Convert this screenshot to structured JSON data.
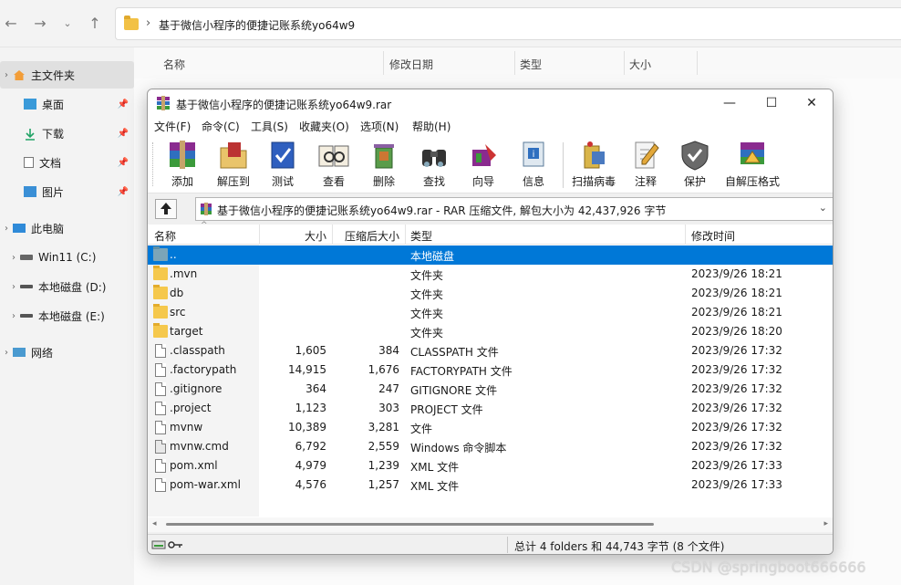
{
  "explorer": {
    "breadcrumb": "基于微信小程序的便捷记账系统yo64w9",
    "columns": [
      "名称",
      "修改日期",
      "类型",
      "大小"
    ],
    "sidebar": [
      {
        "label": "主文件夹",
        "icon": "home-icon"
      },
      {
        "label": "桌面",
        "icon": "desktop-icon"
      },
      {
        "label": "下载",
        "icon": "download-icon"
      },
      {
        "label": "文档",
        "icon": "document-icon"
      },
      {
        "label": "图片",
        "icon": "picture-icon"
      },
      {
        "label": "此电脑",
        "icon": "computer-icon"
      },
      {
        "label": "Win11 (C:)",
        "icon": "drive-icon"
      },
      {
        "label": "本地磁盘 (D:)",
        "icon": "drive-icon"
      },
      {
        "label": "本地磁盘 (E:)",
        "icon": "drive-icon"
      },
      {
        "label": "网络",
        "icon": "network-icon"
      }
    ]
  },
  "winrar": {
    "title": "基于微信小程序的便捷记账系统yo64w9.rar",
    "menu": [
      "文件(F)",
      "命令(C)",
      "工具(S)",
      "收藏夹(O)",
      "选项(N)",
      "帮助(H)"
    ],
    "toolbar": [
      "添加",
      "解压到",
      "测试",
      "查看",
      "删除",
      "查找",
      "向导",
      "信息",
      "扫描病毒",
      "注释",
      "保护",
      "自解压格式"
    ],
    "path": "基于微信小程序的便捷记账系统yo64w9.rar - RAR 压缩文件, 解包大小为 42,437,926 字节",
    "columns": [
      "名称",
      "大小",
      "压缩后大小",
      "类型",
      "修改时间"
    ],
    "rows": [
      {
        "name": "..",
        "size": "",
        "packed": "",
        "type": "本地磁盘",
        "modified": "",
        "kind": "up"
      },
      {
        "name": ".mvn",
        "size": "",
        "packed": "",
        "type": "文件夹",
        "modified": "2023/9/26 18:21",
        "kind": "folder"
      },
      {
        "name": "db",
        "size": "",
        "packed": "",
        "type": "文件夹",
        "modified": "2023/9/26 18:21",
        "kind": "folder"
      },
      {
        "name": "src",
        "size": "",
        "packed": "",
        "type": "文件夹",
        "modified": "2023/9/26 18:21",
        "kind": "folder"
      },
      {
        "name": "target",
        "size": "",
        "packed": "",
        "type": "文件夹",
        "modified": "2023/9/26 18:20",
        "kind": "folder"
      },
      {
        "name": ".classpath",
        "size": "1,605",
        "packed": "384",
        "type": "CLASSPATH 文件",
        "modified": "2023/9/26 17:32",
        "kind": "file"
      },
      {
        "name": ".factorypath",
        "size": "14,915",
        "packed": "1,676",
        "type": "FACTORYPATH 文件",
        "modified": "2023/9/26 17:32",
        "kind": "file"
      },
      {
        "name": ".gitignore",
        "size": "364",
        "packed": "247",
        "type": "GITIGNORE 文件",
        "modified": "2023/9/26 17:32",
        "kind": "file"
      },
      {
        "name": ".project",
        "size": "1,123",
        "packed": "303",
        "type": "PROJECT 文件",
        "modified": "2023/9/26 17:32",
        "kind": "file"
      },
      {
        "name": "mvnw",
        "size": "10,389",
        "packed": "3,281",
        "type": "文件",
        "modified": "2023/9/26 17:32",
        "kind": "file"
      },
      {
        "name": "mvnw.cmd",
        "size": "6,792",
        "packed": "2,559",
        "type": "Windows 命令脚本",
        "modified": "2023/9/26 17:32",
        "kind": "cmd"
      },
      {
        "name": "pom.xml",
        "size": "4,979",
        "packed": "1,239",
        "type": "XML 文件",
        "modified": "2023/9/26 17:33",
        "kind": "file"
      },
      {
        "name": "pom-war.xml",
        "size": "4,576",
        "packed": "1,257",
        "type": "XML 文件",
        "modified": "2023/9/26 17:33",
        "kind": "file"
      }
    ],
    "status": "总计 4 folders 和 44,743 字节 (8 个文件)"
  },
  "watermark": "CSDN @springboot666666"
}
